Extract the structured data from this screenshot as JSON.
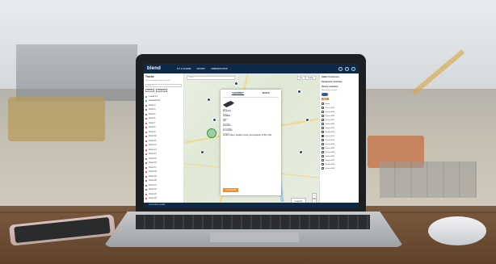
{
  "header": {
    "logo": "blend",
    "nav": [
      "FLT & SCHEME",
      "HISTORY",
      "ADMINISTRATION"
    ]
  },
  "left_panel": {
    "title": "Trucks",
    "subtitle": "Show equipment within location",
    "search_placeholder": "Search",
    "chips": [
      "Vehicles",
      "Equipment"
    ],
    "units": [
      {
        "label": "Loader 21",
        "color": "#2e9c4a"
      },
      {
        "label": "Excavator 19",
        "color": "#2e9c4a"
      },
      {
        "label": "Dozer 3",
        "color": "#d33333"
      },
      {
        "label": "Dozer 4",
        "color": "#d33333"
      },
      {
        "label": "Dozer 5",
        "color": "#d33333"
      },
      {
        "label": "Dozer 6",
        "color": "#d33333"
      },
      {
        "label": "Dozer 7",
        "color": "#d33333"
      },
      {
        "label": "Dozer 8",
        "color": "#d33333"
      },
      {
        "label": "Dozer 9",
        "color": "#d33333"
      },
      {
        "label": "Dozer 10",
        "color": "#d33333"
      },
      {
        "label": "Dozer 11",
        "color": "#d33333"
      },
      {
        "label": "Dozer 12",
        "color": "#d33333"
      },
      {
        "label": "Dozer 13",
        "color": "#d33333"
      },
      {
        "label": "Dozer 14",
        "color": "#d33333"
      },
      {
        "label": "Dozer 15",
        "color": "#d33333"
      },
      {
        "label": "Dozer 16",
        "color": "#d33333"
      },
      {
        "label": "Dozer 17",
        "color": "#d33333"
      },
      {
        "label": "Dozer 18",
        "color": "#d33333"
      },
      {
        "label": "Dozer 19",
        "color": "#d33333"
      },
      {
        "label": "Dozer 20",
        "color": "#d33333"
      },
      {
        "label": "Dozer 21",
        "color": "#d33333"
      },
      {
        "label": "Dozer 22",
        "color": "#d33333"
      },
      {
        "label": "Dozer 23",
        "color": "#d33333"
      },
      {
        "label": "Dozer 24",
        "color": "#d33333"
      }
    ]
  },
  "map": {
    "search_placeholder": "Search",
    "map_types": [
      "Map",
      "Satellite"
    ],
    "legend_label": "Legend",
    "zoom_in": "+",
    "zoom_out": "−"
  },
  "popup": {
    "tabs": [
      "EQUIPMENT",
      "DEVICE"
    ],
    "fields": [
      {
        "label": "Name",
        "value": "Excavator"
      },
      {
        "label": "Status",
        "value": "Available"
      },
      {
        "label": "Model",
        "value": "320"
      },
      {
        "label": "Serial No.",
        "value": "AAA1234"
      },
      {
        "label": "Last Update",
        "value": "21.01.2020"
      },
      {
        "label": "Location",
        "value": "Gordon Street, Franklin County, Pennsylvania, 17201, USA"
      }
    ],
    "button": "Load Details"
  },
  "right_panel": {
    "title": "Slider Functions",
    "section1": "Equipment summary",
    "section2": "Device selection",
    "toggle_label": "Show device tracking",
    "add_label": "ADD",
    "rows": [
      {
        "label": "Name",
        "checked": false
      },
      {
        "label": "Device 4024",
        "checked": false
      },
      {
        "label": "Device 4025",
        "checked": false
      },
      {
        "label": "Device 4026",
        "checked": false
      },
      {
        "label": "Device 4027",
        "checked": false
      },
      {
        "label": "Device 4028",
        "checked": false
      },
      {
        "label": "Device 4029",
        "checked": false
      },
      {
        "label": "Device 4030",
        "checked": false
      },
      {
        "label": "Device 4031",
        "checked": true
      },
      {
        "label": "Device 4032",
        "checked": false
      },
      {
        "label": "Device 4033",
        "checked": false
      },
      {
        "label": "Device 4034",
        "checked": false
      },
      {
        "label": "Device 4035",
        "checked": false
      },
      {
        "label": "Device 4036",
        "checked": false
      },
      {
        "label": "Device 4037",
        "checked": false
      },
      {
        "label": "Device 4038",
        "checked": false
      },
      {
        "label": "Device 4039",
        "checked": false
      }
    ]
  },
  "status_bar": "Last vehicle update"
}
